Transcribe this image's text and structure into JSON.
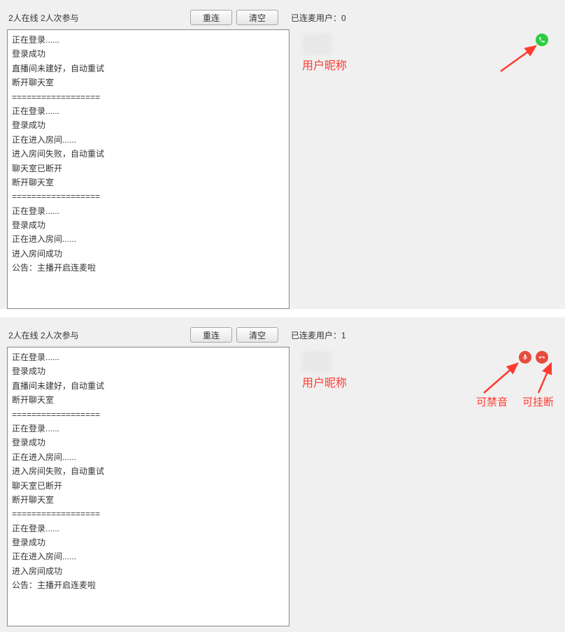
{
  "panel1": {
    "online_info": "2人在线 2人次参与",
    "reconnect_label": "重连",
    "clear_label": "清空",
    "connected_label": "已连麦用户：0",
    "log_lines": [
      "正在登录......",
      "登录成功",
      "直播间未建好，自动重试",
      "断开聊天室",
      "==================",
      "正在登录......",
      "登录成功",
      "正在进入房间......",
      "进入房间失败，自动重试",
      "聊天室已断开",
      "断开聊天室",
      "==================",
      "正在登录......",
      "登录成功",
      "正在进入房间......",
      "进入房间成功",
      "公告：主播开启连麦啦"
    ],
    "nickname_anno": "用户昵称"
  },
  "panel2": {
    "online_info": "2人在线 2人次参与",
    "reconnect_label": "重连",
    "clear_label": "清空",
    "connected_label": "已连麦用户：1",
    "log_lines": [
      "正在登录......",
      "登录成功",
      "直播间未建好，自动重试",
      "断开聊天室",
      "==================",
      "正在登录......",
      "登录成功",
      "正在进入房间......",
      "进入房间失败，自动重试",
      "聊天室已断开",
      "断开聊天室",
      "==================",
      "正在登录......",
      "登录成功",
      "正在进入房间......",
      "进入房间成功",
      "公告：主播开启连麦啦"
    ],
    "nickname_anno": "用户昵称",
    "mute_anno": "可禁音",
    "hangup_anno": "可挂断"
  }
}
